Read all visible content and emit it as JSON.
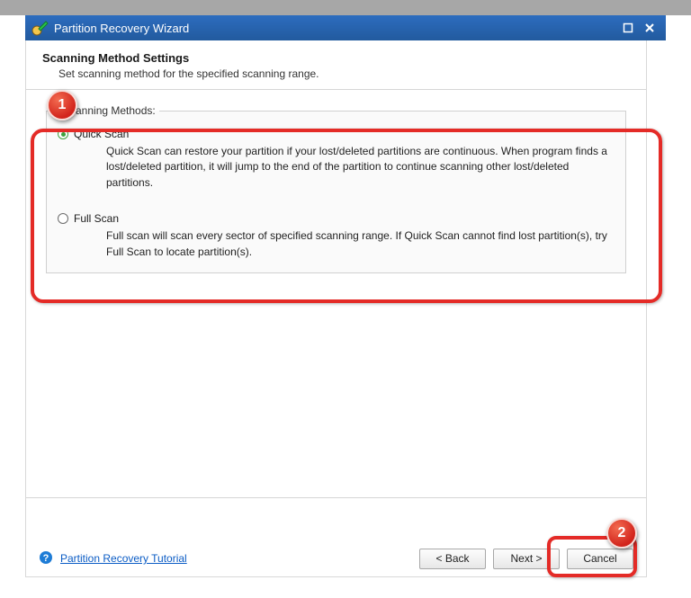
{
  "titlebar": {
    "title": "Partition Recovery Wizard"
  },
  "header": {
    "title": "Scanning Method Settings",
    "subtitle": "Set scanning method for the specified scanning range."
  },
  "fieldset_legend": "Scanning Methods:",
  "options": [
    {
      "label": "Quick Scan",
      "checked": true,
      "desc": "Quick Scan can restore your partition if your lost/deleted partitions are continuous. When program finds a lost/deleted partition, it will jump to the end of the partition to continue scanning other lost/deleted partitions."
    },
    {
      "label": "Full Scan",
      "checked": false,
      "desc": "Full scan will scan every sector of specified scanning range. If Quick Scan cannot find lost partition(s), try Full Scan to locate partition(s)."
    }
  ],
  "footer": {
    "help_link": "Partition Recovery Tutorial",
    "back": "< Back",
    "next": "Next >",
    "cancel": "Cancel"
  },
  "annotations": {
    "badge1": "1",
    "badge2": "2"
  }
}
